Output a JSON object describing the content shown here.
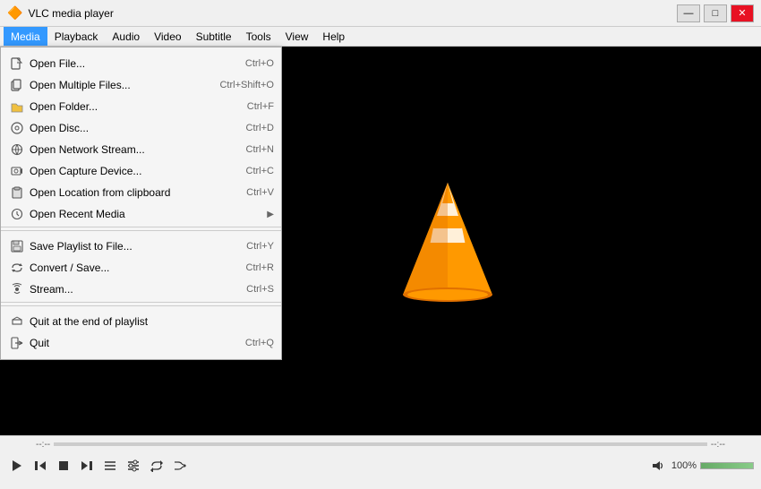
{
  "titlebar": {
    "icon": "🔶",
    "title": "VLC media player",
    "minimize": "—",
    "maximize": "□",
    "close": "✕"
  },
  "menubar": {
    "items": [
      {
        "label": "Media",
        "active": true
      },
      {
        "label": "Playback",
        "active": false
      },
      {
        "label": "Audio",
        "active": false
      },
      {
        "label": "Video",
        "active": false
      },
      {
        "label": "Subtitle",
        "active": false
      },
      {
        "label": "Tools",
        "active": false
      },
      {
        "label": "View",
        "active": false
      },
      {
        "label": "Help",
        "active": false
      }
    ]
  },
  "dropdown": {
    "sections": [
      {
        "items": [
          {
            "icon": "file",
            "label": "Open File...",
            "shortcut": "Ctrl+O"
          },
          {
            "icon": "multi",
            "label": "Open Multiple Files...",
            "shortcut": "Ctrl+Shift+O"
          },
          {
            "icon": "folder",
            "label": "Open Folder...",
            "shortcut": "Ctrl+F"
          },
          {
            "icon": "disc",
            "label": "Open Disc...",
            "shortcut": "Ctrl+D"
          },
          {
            "icon": "network",
            "label": "Open Network Stream...",
            "shortcut": "Ctrl+N"
          },
          {
            "icon": "capture",
            "label": "Open Capture Device...",
            "shortcut": "Ctrl+C"
          },
          {
            "icon": "clipboard",
            "label": "Open Location from clipboard",
            "shortcut": "Ctrl+V"
          },
          {
            "icon": "recent",
            "label": "Open Recent Media",
            "shortcut": "",
            "submenu": true
          }
        ]
      },
      {
        "items": [
          {
            "icon": "save",
            "label": "Save Playlist to File...",
            "shortcut": "Ctrl+Y"
          },
          {
            "icon": "convert",
            "label": "Convert / Save...",
            "shortcut": "Ctrl+R"
          },
          {
            "icon": "stream",
            "label": "Stream...",
            "shortcut": "Ctrl+S"
          }
        ]
      },
      {
        "items": [
          {
            "icon": "quit-end",
            "label": "Quit at the end of playlist",
            "shortcut": ""
          },
          {
            "icon": "quit",
            "label": "Quit",
            "shortcut": "Ctrl+Q"
          }
        ]
      }
    ]
  },
  "controls": {
    "time_left": "--:--",
    "time_right": "--:--",
    "volume_label": "100%",
    "buttons": [
      "prev",
      "stop",
      "play",
      "next",
      "playlist",
      "extended",
      "playlist2",
      "loop",
      "random"
    ]
  }
}
